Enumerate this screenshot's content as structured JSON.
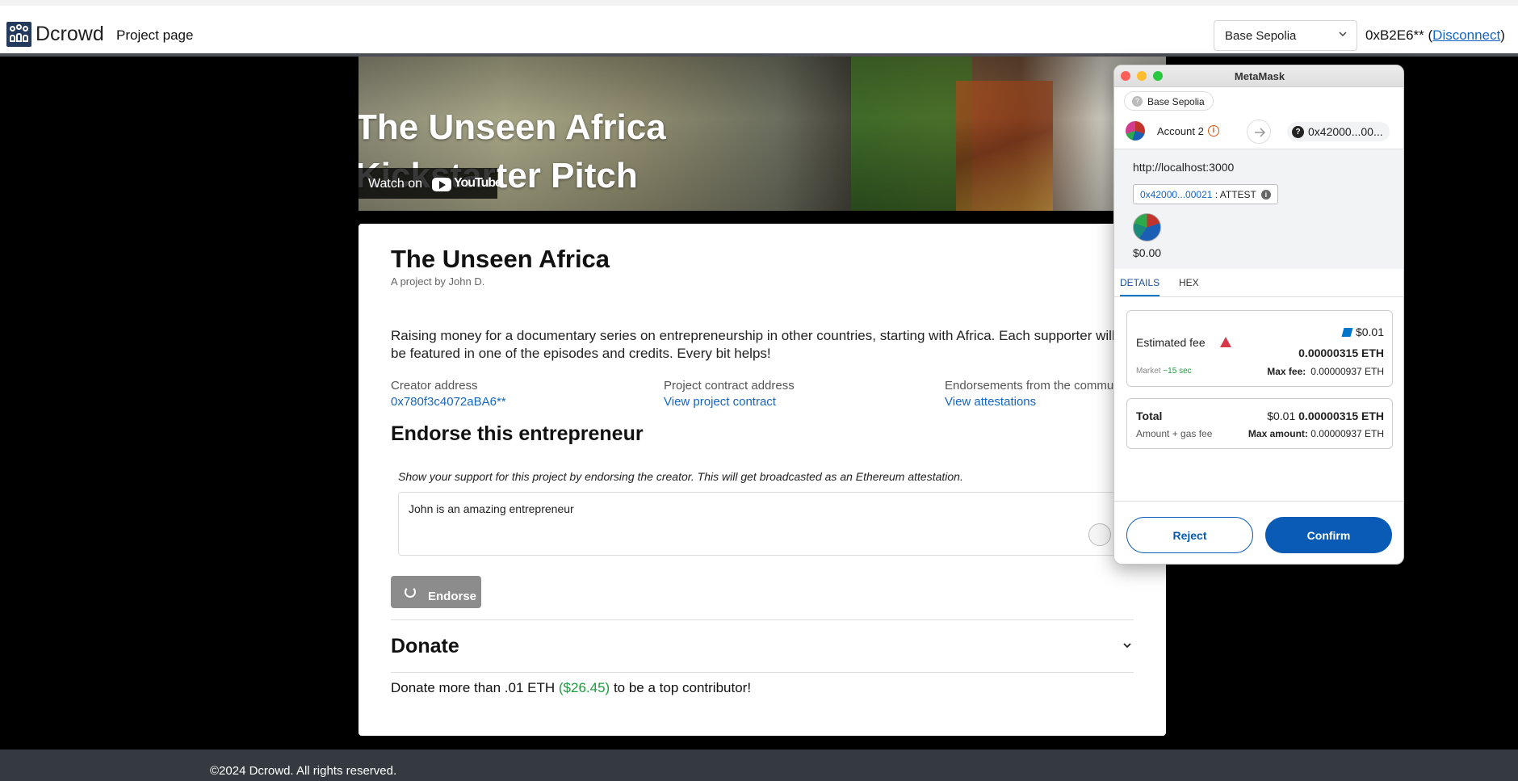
{
  "navbar": {
    "brand": "Dcrowd",
    "page_link": "Project page",
    "network_select": "Base Sepolia",
    "account": "0xB2E6**",
    "disconnect": "Disconnect"
  },
  "video": {
    "title_line1": "The Unseen Africa",
    "title_line2": "Kickstarter Pitch",
    "watch_on": "Watch on",
    "youtube": "YouTube"
  },
  "project": {
    "title": "The Unseen Africa",
    "byline": "A project by John D.",
    "description_line1": "Raising money for a documentary series on entrepreneurship in other countries, starting with Africa. Each supporter will",
    "description_line2": "be featured in one of the episodes and credits. Every bit helps!",
    "creator_label": "Creator address",
    "creator_value": "0x780f3c4072aBA6**",
    "contract_label": "Project contract address",
    "contract_value": "View project contract",
    "endorsements_label": "Endorsements from the community",
    "endorsements_value": "View attestations"
  },
  "endorse": {
    "heading": "Endorse this entrepreneur",
    "hint": "Show your support for this project by endorsing the creator. This will get broadcasted as an Ethereum attestation.",
    "input_value": "John is an amazing entrepreneur",
    "button": "Endorse"
  },
  "donate": {
    "heading": "Donate",
    "text_before": "Donate more than .01 ETH ",
    "text_usd": "($26.45)",
    "text_after": " to be a top contributor!"
  },
  "footer": {
    "copyright": "©2024 Dcrowd. All rights reserved."
  },
  "metamask": {
    "window_title": "MetaMask",
    "network": "Base Sepolia",
    "account_name": "Account 2",
    "to_address": "0x42000...00...",
    "origin": "http://localhost:3000",
    "method_address": "0x42000...00021",
    "method_name": ": ATTEST",
    "balance": "$0.00",
    "tab_details": "DETAILS",
    "tab_hex": "HEX",
    "fee_label": "Estimated fee",
    "fee_usd": "$0.01",
    "fee_eth": "0.00000315 ETH",
    "market_label": "Market",
    "market_time": "~15 sec",
    "max_fee_label": "Max fee:",
    "max_fee_value": "0.00000937 ETH",
    "total_label": "Total",
    "total_sub": "Amount + gas fee",
    "total_usd": "$0.01",
    "total_eth": "0.00000315 ETH",
    "max_amount_label": "Max amount:",
    "max_amount_value": "0.00000937 ETH",
    "reject": "Reject",
    "confirm": "Confirm"
  },
  "colors": {
    "link_blue": "#1565c0",
    "metamask_blue": "#0a5bb5",
    "green": "#1f9a3f",
    "footer_bg": "#343a40",
    "warning_red": "#d73847"
  },
  "icons": [
    "people-logo-icon",
    "chevron-down-icon",
    "youtube-icon",
    "spinner-icon",
    "grammarly-icon",
    "info-icon",
    "arrow-right-icon",
    "question-icon",
    "warning-icon",
    "pencil-icon"
  ]
}
